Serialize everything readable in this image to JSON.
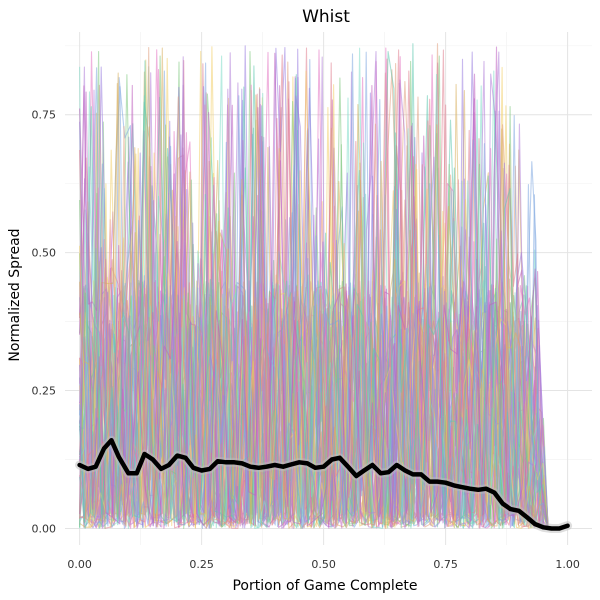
{
  "chart_data": {
    "type": "line",
    "title": "Whist",
    "xlabel": "Portion of Game Complete",
    "ylabel": "Normalized Spread",
    "xlim": [
      -0.03,
      1.05
    ],
    "ylim": [
      -0.03,
      0.9
    ],
    "x_ticks": [
      0.0,
      0.25,
      0.5,
      0.75,
      1.0
    ],
    "x_tick_labels": [
      "0.00",
      "0.25",
      "0.50",
      "0.75",
      "1.00"
    ],
    "y_ticks": [
      0.0,
      0.25,
      0.5,
      0.75
    ],
    "y_tick_labels": [
      "0.00",
      "0.25",
      "0.50",
      "0.75"
    ],
    "grid": true,
    "legend": "none",
    "background_series": {
      "count": 60,
      "opacity": 0.55,
      "line_width": 1.1,
      "palette": [
        "#e377c2",
        "#9a7fe0",
        "#7fc97f",
        "#e0a080",
        "#f2d06b",
        "#80dcc8",
        "#e08090",
        "#b07fd8",
        "#7fa8e0",
        "#d8b060",
        "#60c8b0",
        "#c060c0"
      ],
      "x_max": 0.96,
      "decay_start": 0.92,
      "typical_range": [
        0.0,
        0.45
      ],
      "peak_max": 0.88
    },
    "series": [
      {
        "role": "mean",
        "color": "#000000",
        "x": [
          0.0,
          0.017,
          0.033,
          0.05,
          0.065,
          0.08,
          0.1,
          0.117,
          0.133,
          0.15,
          0.167,
          0.183,
          0.2,
          0.217,
          0.233,
          0.25,
          0.267,
          0.283,
          0.3,
          0.317,
          0.333,
          0.35,
          0.367,
          0.383,
          0.4,
          0.417,
          0.433,
          0.45,
          0.467,
          0.483,
          0.5,
          0.517,
          0.533,
          0.55,
          0.567,
          0.583,
          0.6,
          0.617,
          0.633,
          0.65,
          0.667,
          0.683,
          0.7,
          0.717,
          0.733,
          0.75,
          0.767,
          0.783,
          0.8,
          0.817,
          0.833,
          0.85,
          0.867,
          0.883,
          0.9,
          0.917,
          0.933,
          0.95,
          0.967,
          0.983,
          1.0
        ],
        "y": [
          0.115,
          0.108,
          0.112,
          0.145,
          0.16,
          0.13,
          0.1,
          0.1,
          0.135,
          0.125,
          0.108,
          0.115,
          0.132,
          0.128,
          0.11,
          0.105,
          0.108,
          0.122,
          0.12,
          0.12,
          0.118,
          0.112,
          0.11,
          0.112,
          0.115,
          0.112,
          0.116,
          0.12,
          0.118,
          0.11,
          0.112,
          0.125,
          0.128,
          0.112,
          0.095,
          0.105,
          0.115,
          0.1,
          0.102,
          0.115,
          0.105,
          0.098,
          0.098,
          0.085,
          0.085,
          0.083,
          0.078,
          0.075,
          0.072,
          0.07,
          0.072,
          0.065,
          0.045,
          0.035,
          0.032,
          0.02,
          0.008,
          0.002,
          0.0,
          0.0,
          0.005
        ]
      }
    ]
  }
}
